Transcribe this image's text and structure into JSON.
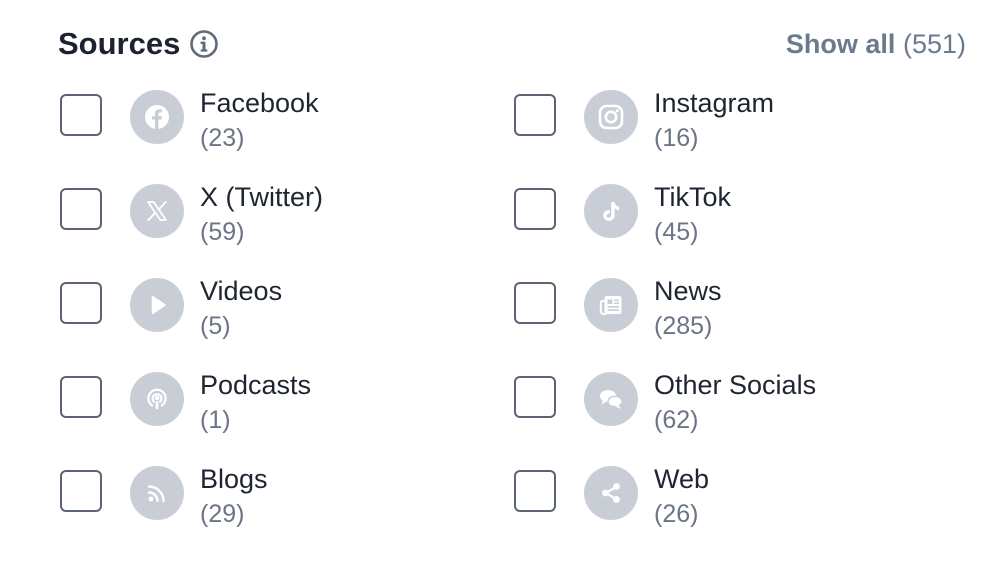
{
  "sources": {
    "title": "Sources",
    "show_all_label": "Show all",
    "show_all_count": "(551)",
    "items": [
      {
        "label": "Facebook",
        "count": "(23)",
        "icon": "facebook-icon"
      },
      {
        "label": "Instagram",
        "count": "(16)",
        "icon": "instagram-icon"
      },
      {
        "label": "X (Twitter)",
        "count": "(59)",
        "icon": "x-twitter-icon"
      },
      {
        "label": "TikTok",
        "count": "(45)",
        "icon": "tiktok-icon"
      },
      {
        "label": "Videos",
        "count": "(5)",
        "icon": "play-icon"
      },
      {
        "label": "News",
        "count": "(285)",
        "icon": "newspaper-icon"
      },
      {
        "label": "Podcasts",
        "count": "(1)",
        "icon": "podcast-icon"
      },
      {
        "label": "Other Socials",
        "count": "(62)",
        "icon": "chat-bubbles-icon"
      },
      {
        "label": "Blogs",
        "count": "(29)",
        "icon": "rss-icon"
      },
      {
        "label": "Web",
        "count": "(26)",
        "icon": "share-icon"
      }
    ]
  },
  "colors": {
    "title": "#1c2230",
    "muted": "#6b7a8c",
    "icon_bg": "#c9ced6",
    "checkbox_border": "#5a6473"
  }
}
